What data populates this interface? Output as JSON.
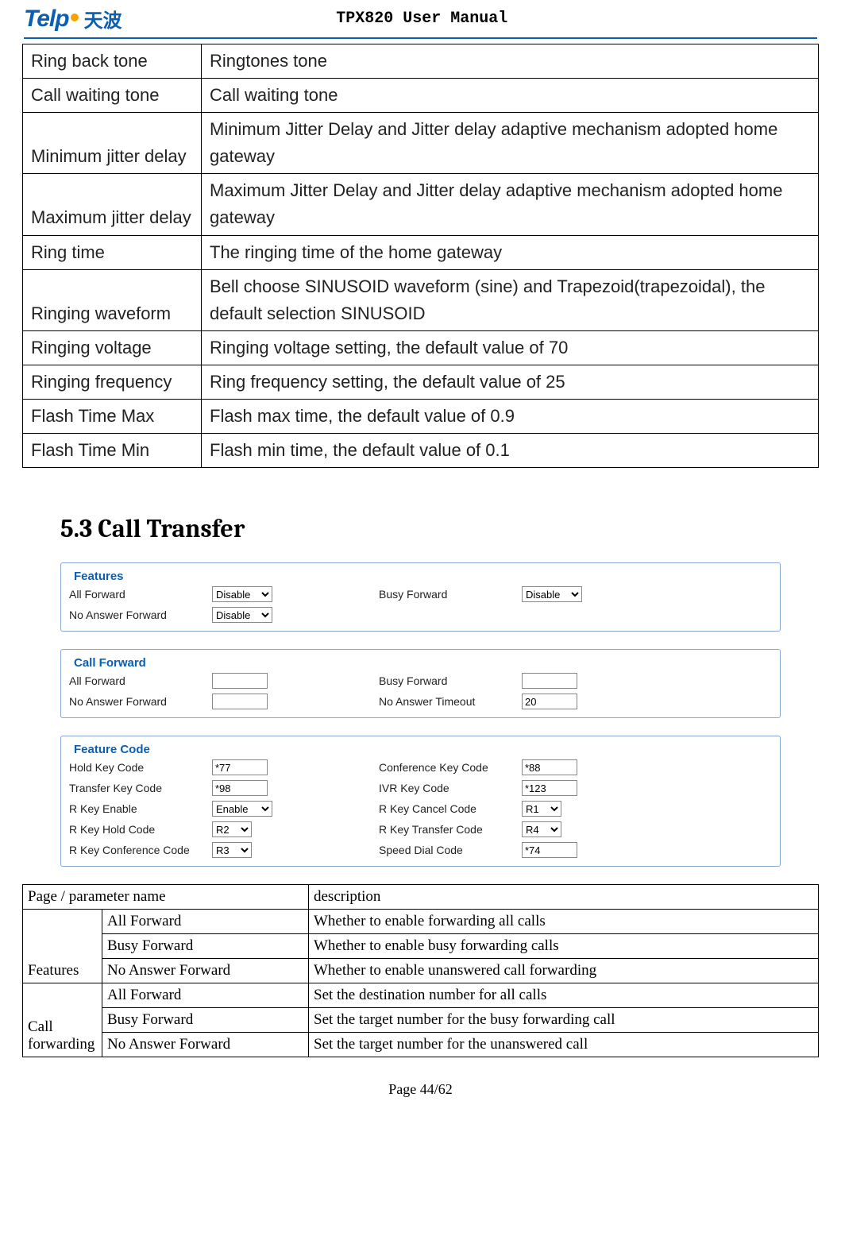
{
  "header": {
    "logo_text": "Telp",
    "logo_cn": "天波",
    "title": "TPX820 User Manual"
  },
  "desc_table": {
    "rows": [
      {
        "name": "Ring back tone",
        "desc": "Ringtones tone"
      },
      {
        "name": "Call waiting tone",
        "desc": "Call waiting tone"
      },
      {
        "name": "Minimum jitter delay",
        "desc": "Minimum Jitter Delay and Jitter delay adaptive mechanism adopted home gateway"
      },
      {
        "name": "Maximum jitter delay",
        "desc": "Maximum Jitter Delay and Jitter delay adaptive mechanism adopted home gateway"
      },
      {
        "name": "Ring time",
        "desc": "The ringing time of the home gateway"
      },
      {
        "name": "Ringing waveform",
        "desc": "Bell choose SINUSOID waveform (sine) and Trapezoid(trapezoidal), the default selection SINUSOID"
      },
      {
        "name": "Ringing voltage",
        "desc": "Ringing voltage setting, the default value of 70"
      },
      {
        "name": "Ringing frequency",
        "desc": "Ring frequency setting, the default value of 25"
      },
      {
        "name": "Flash Time Max",
        "desc": "Flash max time, the default value of 0.9"
      },
      {
        "name": "Flash Time Min",
        "desc": "Flash min time, the default value of 0.1"
      }
    ]
  },
  "section_heading": "5.3 Call Transfer",
  "features_panel": {
    "legend": "Features",
    "all_forward_label": "All Forward",
    "all_forward_value": "Disable",
    "busy_forward_label": "Busy Forward",
    "busy_forward_value": "Disable",
    "no_answer_forward_label": "No Answer Forward",
    "no_answer_forward_value": "Disable"
  },
  "call_forward_panel": {
    "legend": "Call Forward",
    "all_forward_label": "All Forward",
    "all_forward_value": "",
    "busy_forward_label": "Busy Forward",
    "busy_forward_value": "",
    "no_answer_forward_label": "No Answer Forward",
    "no_answer_forward_value": "",
    "no_answer_timeout_label": "No Answer Timeout",
    "no_answer_timeout_value": "20"
  },
  "feature_code_panel": {
    "legend": "Feature Code",
    "hold_key_label": "Hold Key Code",
    "hold_key_value": "*77",
    "conference_key_label": "Conference Key Code",
    "conference_key_value": "*88",
    "transfer_key_label": "Transfer Key Code",
    "transfer_key_value": "*98",
    "ivr_key_label": "IVR Key Code",
    "ivr_key_value": "*123",
    "rkey_enable_label": "R Key Enable",
    "rkey_enable_value": "Enable",
    "rkey_cancel_label": "R Key Cancel Code",
    "rkey_cancel_value": "R1",
    "rkey_hold_label": "R Key Hold Code",
    "rkey_hold_value": "R2",
    "rkey_transfer_label": "R Key Transfer Code",
    "rkey_transfer_value": "R4",
    "rkey_conference_label": "R Key Conference Code",
    "rkey_conference_value": "R3",
    "speed_dial_label": "Speed Dial Code",
    "speed_dial_value": "*74"
  },
  "param_table": {
    "header_name": "Page / parameter name",
    "header_desc": "description",
    "group_features": "Features",
    "group_call_forwarding": "Call forwarding",
    "rows_features": [
      {
        "name": "All Forward",
        "desc": "Whether to enable forwarding all calls"
      },
      {
        "name": "Busy Forward",
        "desc": "Whether to enable busy forwarding calls"
      },
      {
        "name": "No Answer Forward",
        "desc": "Whether to enable unanswered call forwarding"
      }
    ],
    "rows_call_forwarding": [
      {
        "name": "All Forward",
        "desc": "Set the destination number for all calls"
      },
      {
        "name": "Busy Forward",
        "desc": "Set the target number for the busy forwarding call"
      },
      {
        "name": "No Answer Forward",
        "desc": "Set the target number for the unanswered call"
      }
    ]
  },
  "footer": "Page 44/62"
}
